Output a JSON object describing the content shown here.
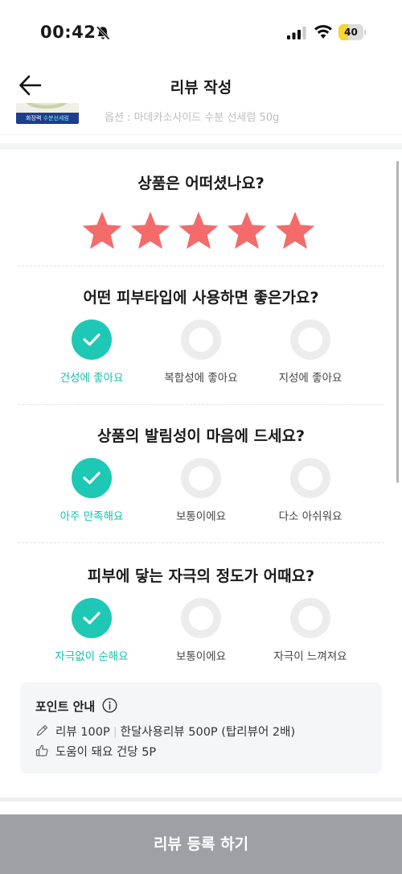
{
  "status_bar": {
    "time": "00:42",
    "battery_level": "40",
    "battery_fraction": 0.4
  },
  "nav": {
    "title": "리뷰 작성",
    "back_icon": "arrow-left-icon"
  },
  "product": {
    "thumbnail_band_text": "화장력",
    "thumbnail_band_accent": "수분선세럼",
    "option_text": "옵션 : 마데카소사이드 수분 선세럼 50g"
  },
  "rating": {
    "question": "상품은 어떠셨나요?",
    "value": 5,
    "max": 5,
    "star_color": "#f36b6b"
  },
  "questions": [
    {
      "question": "어떤 피부타입에 사용하면 좋은가요?",
      "options": [
        {
          "label": "건성에 좋아요",
          "selected": true
        },
        {
          "label": "복합성에 좋아요",
          "selected": false
        },
        {
          "label": "지성에 좋아요",
          "selected": false
        }
      ]
    },
    {
      "question": "상품의 발림성이 마음에 드세요?",
      "options": [
        {
          "label": "아주 만족해요",
          "selected": true
        },
        {
          "label": "보통이에요",
          "selected": false
        },
        {
          "label": "다소 아쉬워요",
          "selected": false
        }
      ]
    },
    {
      "question": "피부에 닿는 자극의 정도가 어때요?",
      "options": [
        {
          "label": "자극없이 순해요",
          "selected": true
        },
        {
          "label": "보통이에요",
          "selected": false
        },
        {
          "label": "자극이 느껴져요",
          "selected": false
        }
      ]
    }
  ],
  "points": {
    "title": "포인트 안내",
    "review_points": "리뷰 100P",
    "month_review_points": "한달사용리뷰 500P (탑리뷰어 2배)",
    "helpful_points": "도움이 돼요 건당 5P"
  },
  "submit_label": "리뷰 등록 하기",
  "colors": {
    "accent": "#1fc8b4",
    "accent_text": "#16bfae",
    "star": "#f36b6b",
    "submit_disabled": "#9ea0a4"
  }
}
